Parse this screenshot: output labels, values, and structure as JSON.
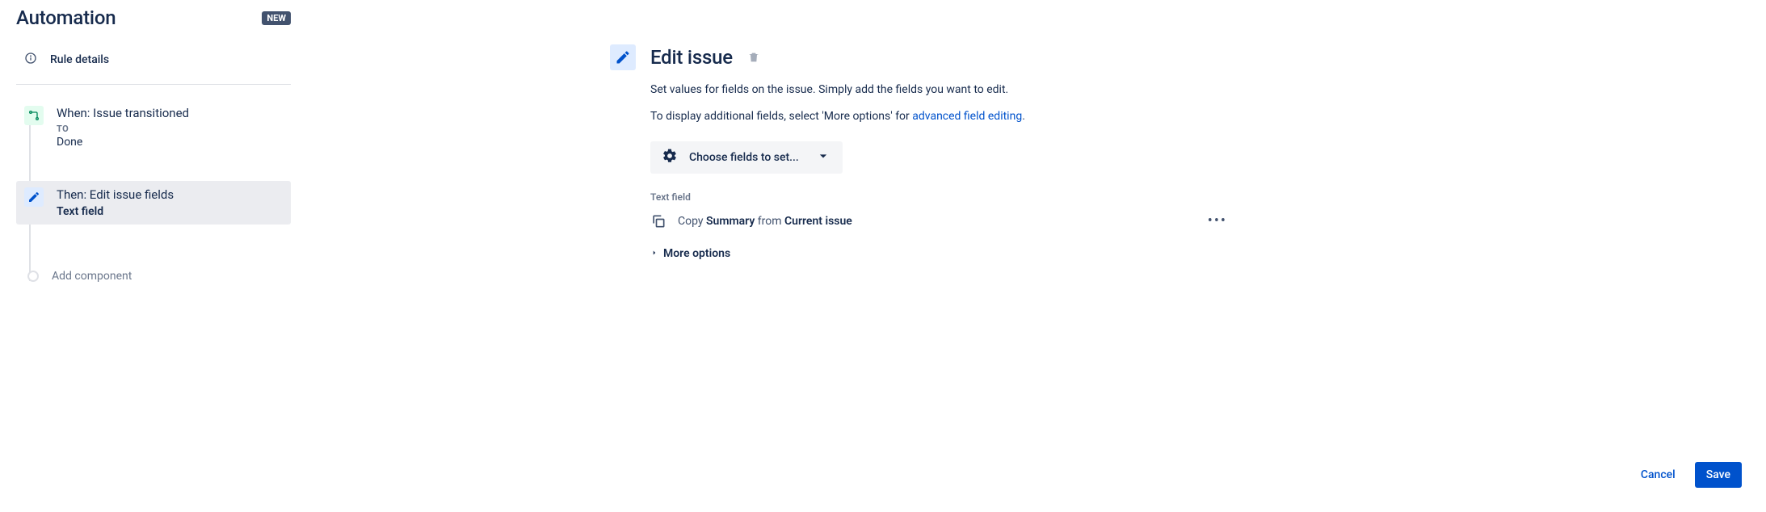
{
  "header": {
    "title": "Automation",
    "badge": "NEW"
  },
  "sidebar": {
    "rule_details_label": "Rule details",
    "trigger": {
      "title": "When: Issue transitioned",
      "meta_label": "TO",
      "value": "Done"
    },
    "action": {
      "title": "Then: Edit issue fields",
      "detail": "Text field"
    },
    "add_component_label": "Add component"
  },
  "panel": {
    "title": "Edit issue",
    "description_1": "Set values for fields on the issue. Simply add the fields you want to edit.",
    "description_2_prefix": "To display additional fields, select 'More options' for ",
    "description_2_link": "advanced field editing",
    "description_2_suffix": ".",
    "field_picker_label": "Choose fields to set...",
    "field_section_label": "Text field",
    "copy_line": {
      "prefix": "Copy ",
      "field": "Summary",
      "middle": " from ",
      "source": "Current issue"
    },
    "more_options_label": "More options"
  },
  "footer": {
    "cancel": "Cancel",
    "save": "Save"
  }
}
